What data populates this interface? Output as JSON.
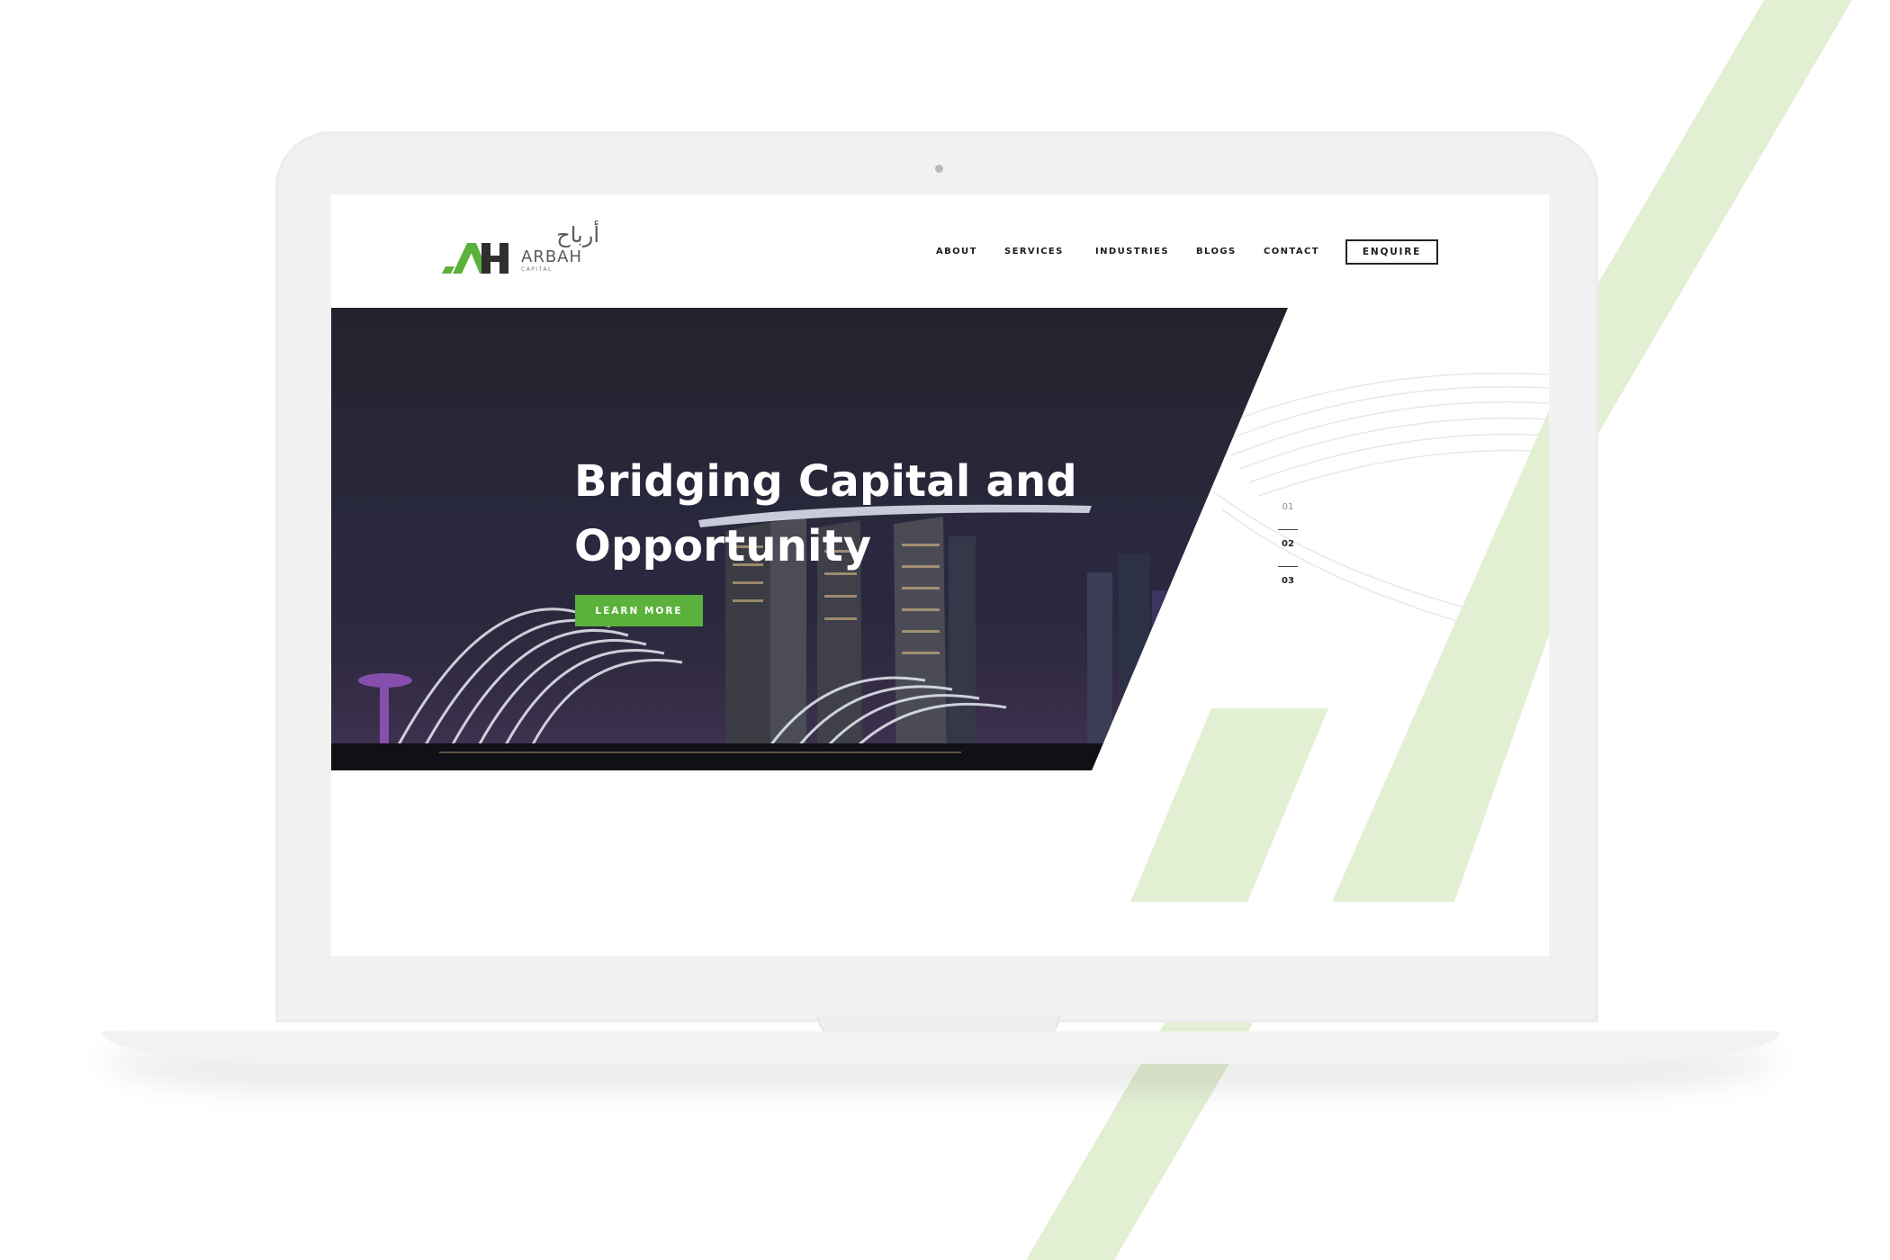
{
  "brand": {
    "name": "ARBAH",
    "tagline": "CAPITAL",
    "arabic": "أرباح",
    "accent_color": "#5bb13c",
    "stripe_color": "#e3efd3"
  },
  "nav": {
    "items": [
      {
        "label": "ABOUT"
      },
      {
        "label": "SERVICES"
      },
      {
        "label": "INDUSTRIES"
      },
      {
        "label": "BLOGS"
      },
      {
        "label": "CONTACT"
      }
    ],
    "enquire_label": "ENQUIRE"
  },
  "hero": {
    "title": "Bridging Capital and Opportunity",
    "cta_label": "LEARN MORE"
  },
  "pager": {
    "items": [
      "01",
      "02",
      "03"
    ],
    "active": "02"
  }
}
